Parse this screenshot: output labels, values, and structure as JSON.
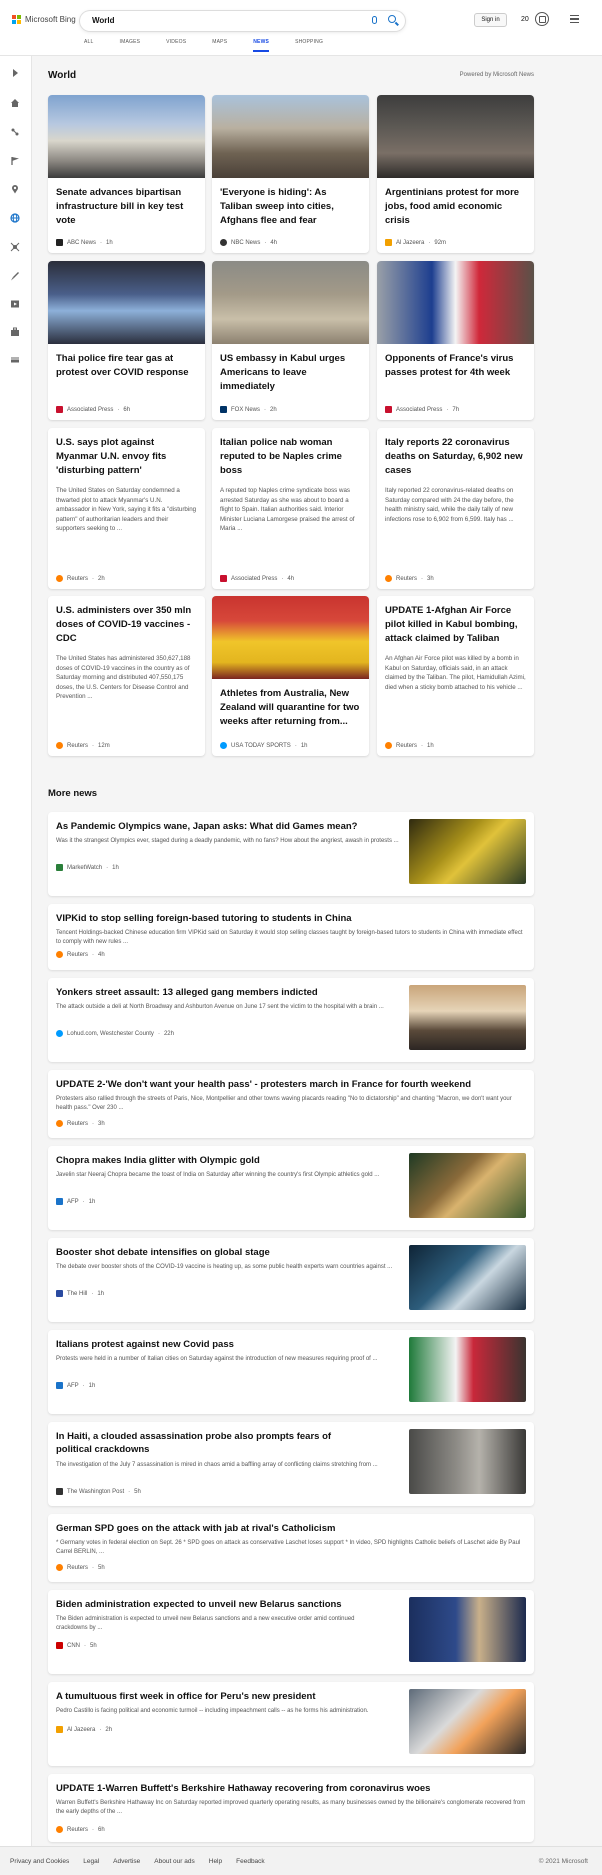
{
  "header": {
    "brand": "Microsoft Bing",
    "search_value": "World",
    "sign_in": "Sign in",
    "rewards_count": "20",
    "tabs": [
      "ALL",
      "IMAGES",
      "VIDEOS",
      "MAPS",
      "NEWS",
      "SHOPPING"
    ],
    "active_tab": "NEWS"
  },
  "rail": {
    "icons": [
      "expand-icon",
      "home-icon",
      "discover-icon",
      "flag-icon",
      "location-icon",
      "globe-icon",
      "technology-icon",
      "science-icon",
      "entertainment-icon",
      "business-icon",
      "money-icon"
    ]
  },
  "section": {
    "title": "World",
    "powered_by": "Powered by Microsoft News"
  },
  "cards": [
    {
      "title": "Senate advances bipartisan infrastructure bill in key test vote",
      "source": "ABC News",
      "time": "1h",
      "logo_color": "#222222"
    },
    {
      "title": "'Everyone is hiding': As Taliban sweep into cities, Afghans flee and fear",
      "source": "NBC News",
      "time": "4h",
      "logo_color": "#333333"
    },
    {
      "title": "Argentinians protest for more jobs, food amid economic crisis",
      "source": "Al Jazeera",
      "time": "92m",
      "logo_color": "#f2a000"
    },
    {
      "title": "Thai police fire tear gas at protest over COVID response",
      "source": "Associated Press",
      "time": "6h",
      "logo_color": "#c8102e"
    },
    {
      "title": "US embassy in Kabul urges Americans to leave immediately",
      "source": "FOX News",
      "time": "2h",
      "logo_color": "#003366"
    },
    {
      "title": "Opponents of France's virus passes protest for 4th week",
      "source": "Associated Press",
      "time": "7h",
      "logo_color": "#c8102e"
    },
    {
      "title": "U.S. says plot against Myanmar U.N. envoy fits 'disturbing pattern'",
      "snippet": "The United States on Saturday condemned a thwarted plot to attack Myanmar's U.N. ambassador in New York, saying it fits a \"disturbing pattern\" of authoritarian leaders and their supporters seeking to ...",
      "source": "Reuters",
      "time": "2h",
      "logo_color": "#ff8000"
    },
    {
      "title": "Italian police nab woman reputed to be Naples crime boss",
      "snippet": "A reputed top Naples crime syndicate boss was arrested Saturday as she was about to board a flight to Spain. Italian authorities said. Interior Minister Luciana Lamorgese praised the arrest of Maria ...",
      "source": "Associated Press",
      "time": "4h",
      "logo_color": "#c8102e"
    },
    {
      "title": "Italy reports 22 coronavirus deaths on Saturday, 6,902 new cases",
      "snippet": "Italy reported 22 coronavirus-related deaths on Saturday compared with 24 the day before, the health ministry said, while the daily tally of new infections rose to 6,902 from 6,599. Italy has ...",
      "source": "Reuters",
      "time": "3h",
      "logo_color": "#ff8000"
    },
    {
      "title": "U.S. administers over 350 mln doses of COVID-19 vaccines - CDC",
      "snippet": "The United States has administered 350,627,188 doses of COVID-19 vaccines in the country as of Saturday morning and distributed 407,550,175 doses, the U.S. Centers for Disease Control and Prevention ...",
      "source": "Reuters",
      "time": "12m",
      "logo_color": "#ff8000"
    },
    {
      "title": "Athletes from Australia, New Zealand will quarantine for two weeks after returning from...",
      "source": "USA TODAY SPORTS",
      "time": "1h",
      "logo_color": "#009bff"
    },
    {
      "title": "UPDATE 1-Afghan Air Force pilot killed in Kabul bombing, attack claimed by Taliban",
      "snippet": "An Afghan Air Force pilot was killed by a bomb in Kabul on Saturday, officials said, in an attack claimed by the Taliban. The pilot, Hamidullah Azimi, died when a sticky bomb attached to his vehicle ...",
      "source": "Reuters",
      "time": "1h",
      "logo_color": "#ff8000"
    }
  ],
  "more_news": {
    "title": "More news",
    "items": [
      {
        "title": "As Pandemic Olympics wane, Japan asks: What did Games mean?",
        "snippet": "Was it the strangest Olympics ever, staged during a deadly pandemic, with no fans? How about the angriest, awash in protests ...",
        "source": "MarketWatch",
        "time": "1h",
        "logo_color": "#2a7f3a"
      },
      {
        "title": "VIPKid to stop selling foreign-based tutoring to students in China",
        "snippet": "Tencent Holdings-backed Chinese education firm VIPKid said on Saturday it would stop selling classes taught by foreign-based tutors to students in China with immediate effect to comply with new rules ...",
        "source": "Reuters",
        "time": "4h",
        "logo_color": "#ff8000"
      },
      {
        "title": "Yonkers street assault: 13 alleged gang members indicted",
        "snippet": "The attack outside a deli at North Broadway and Ashburton Avenue on June 17 sent the victim to the hospital with a brain ...",
        "source": "Lohud.com, Westchester County",
        "time": "22h",
        "logo_color": "#009bff"
      },
      {
        "title": "UPDATE 2-'We don't want your health pass' - protesters march in France for fourth weekend",
        "snippet": "Protesters also rallied through the streets of Paris, Nice, Montpellier and other towns waving placards reading \"No to dictatorship\" and chanting \"Macron, we don't want your health pass.\" Over 230 ...",
        "source": "Reuters",
        "time": "3h",
        "logo_color": "#ff8000"
      },
      {
        "title": "Chopra makes India glitter with Olympic gold",
        "snippet": "Javelin star Neeraj Chopra became the toast of India on Saturday after winning the country's first Olympic athletics gold ...",
        "source": "AFP",
        "time": "1h",
        "logo_color": "#1a73c9"
      },
      {
        "title": "Booster shot debate intensifies on global stage",
        "snippet": "The debate over booster shots of the COVID-19 vaccine is heating up, as some public health experts warn countries against ...",
        "source": "The Hill",
        "time": "1h",
        "logo_color": "#2a4aa0"
      },
      {
        "title": "Italians protest against new Covid pass",
        "snippet": "Protests were held in a number of Italian cities on Saturday against the introduction of new measures requiring proof of ...",
        "source": "AFP",
        "time": "1h",
        "logo_color": "#1a73c9"
      },
      {
        "title": "In Haiti, a clouded assassination probe also prompts fears of political crackdowns",
        "snippet": "The investigation of the July 7 assassination is mired in chaos amid a baffling array of conflicting claims stretching from ...",
        "source": "The Washington Post",
        "time": "5h",
        "logo_color": "#333333"
      },
      {
        "title": "German SPD goes on the attack with jab at rival's Catholicism",
        "snippet": "* Germany votes in federal election on Sept. 26 * SPD goes on attack as conservative Laschet loses support * In video, SPD highlights Catholic beliefs of Laschet aide By Paul Carrel BERLIN, ...",
        "source": "Reuters",
        "time": "5h",
        "logo_color": "#ff8000"
      },
      {
        "title": "Biden administration expected to unveil new Belarus sanctions",
        "snippet": "The Biden administration is expected to unveil new Belarus sanctions and a new executive order amid continued crackdowns by ...",
        "source": "CNN",
        "time": "5h",
        "logo_color": "#cc0000"
      },
      {
        "title": "A tumultuous first week in office for Peru's new president",
        "snippet": "Pedro Castillo is facing political and economic turmoil -- including impeachment calls -- as he forms his administration.",
        "source": "Al Jazeera",
        "time": "2h",
        "logo_color": "#f2a000"
      },
      {
        "title": "UPDATE 1-Warren Buffett's Berkshire Hathaway recovering from coronavirus woes",
        "snippet": "Warren Buffett's Berkshire Hathaway Inc on Saturday reported improved quarterly operating results, as many businesses owned by the billionaire's conglomerate recovered from the early depths of the ...",
        "source": "Reuters",
        "time": "6h",
        "logo_color": "#ff8000"
      }
    ]
  },
  "footer": {
    "links": [
      "Privacy and Cookies",
      "Legal",
      "Advertise",
      "About our ads",
      "Help",
      "Feedback"
    ],
    "copyright": "© 2021 Microsoft"
  }
}
